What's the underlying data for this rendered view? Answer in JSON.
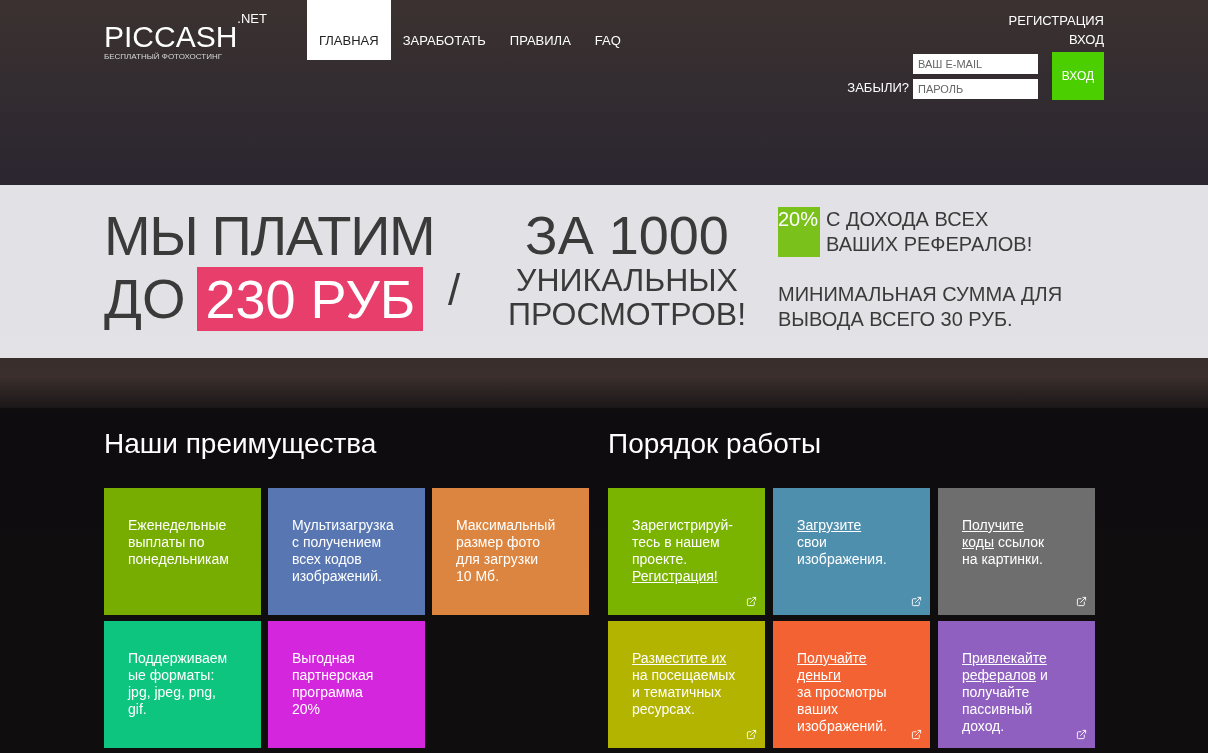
{
  "logo": {
    "name": "PICCASH",
    "tld": ".NET",
    "tagline": "БЕСПЛАТНЫЙ ФОТОХОСТИНГ"
  },
  "nav": [
    {
      "label": "ГЛАВНАЯ",
      "selected": true
    },
    {
      "label": "ЗАРАБОТАТЬ",
      "selected": false
    },
    {
      "label": "ПРАВИЛА",
      "selected": false
    },
    {
      "label": "FAQ",
      "selected": false
    }
  ],
  "account_links": [
    "РЕГИСТРАЦИЯ",
    "ВХОД"
  ],
  "login": {
    "forgot": "ЗАБЫЛИ?",
    "email_placeholder": "ВАШ E-MAIL",
    "password_placeholder": "ПАРОЛЬ",
    "submit": "ВХОД"
  },
  "banner": {
    "line1": "МЫ ПЛАТИМ",
    "line2_prefix": "ДО",
    "highlight": "230 РУБ",
    "slash": "/",
    "right_lines": [
      "ЗА 1000",
      "УНИКАЛЬНЫХ",
      "ПРОСМОТРОВ!"
    ],
    "referral_badge": "20%",
    "referral_text": "С ДОХОДА ВСЕХ ВАШИХ РЕФЕРАЛОВ!",
    "minimum_text": "МИНИМАЛЬНАЯ СУММА ДЛЯ ВЫВОДА ВСЕГО 30 РУБ."
  },
  "advantages": {
    "title": "Наши преимущества",
    "tiles": [
      {
        "color": "#76ad00",
        "lines": [
          [
            {
              "text": "Еженедельные"
            }
          ],
          [
            {
              "text": "выплаты по"
            }
          ],
          [
            {
              "text": "понедельникам"
            }
          ]
        ]
      },
      {
        "color": "#5877b2",
        "lines": [
          [
            {
              "text": "Мультизагрузка"
            }
          ],
          [
            {
              "text": "с получением"
            }
          ],
          [
            {
              "text": "всех кодов"
            }
          ],
          [
            {
              "text": "изображений."
            }
          ]
        ]
      },
      {
        "color": "#dc8540",
        "lines": [
          [
            {
              "text": "Максимальный"
            }
          ],
          [
            {
              "text": "размер фото"
            }
          ],
          [
            {
              "text": "для загрузки"
            }
          ],
          [
            {
              "text": "10 Мб."
            }
          ]
        ]
      },
      {
        "color": "#0ec57f",
        "lines": [
          [
            {
              "text": "Поддерживаем"
            }
          ],
          [
            {
              "text": "ые форматы:"
            }
          ],
          [
            {
              "text": "jpg, jpeg, png,"
            }
          ],
          [
            {
              "text": "gif."
            }
          ]
        ]
      },
      {
        "color": "#d426dc",
        "lines": [
          [
            {
              "text": "Выгодная"
            }
          ],
          [
            {
              "text": "партнерская"
            }
          ],
          [
            {
              "text": "программа"
            }
          ],
          [
            {
              "text": "20%"
            }
          ]
        ]
      }
    ]
  },
  "workflow": {
    "title": "Порядок работы",
    "tiles": [
      {
        "color": "#7ab300",
        "lines": [
          [
            {
              "text": "Зарегистрируй-"
            }
          ],
          [
            {
              "text": "тесь в нашем"
            }
          ],
          [
            {
              "text": "проекте."
            }
          ],
          [
            {
              "text": "Регистрация!",
              "link": true
            }
          ]
        ]
      },
      {
        "color": "#4f8fae",
        "lines": [
          [
            {
              "text": "Загрузите",
              "link": true
            }
          ],
          [
            {
              "text": "свои"
            }
          ],
          [
            {
              "text": "изображения."
            }
          ]
        ]
      },
      {
        "color": "#6e6e6e",
        "lines": [
          [
            {
              "text": "Получите",
              "link": true
            }
          ],
          [
            {
              "text": "коды",
              "link": true
            },
            {
              "text": " ссылок"
            }
          ],
          [
            {
              "text": "на картинки."
            }
          ]
        ]
      },
      {
        "color": "#b2b400",
        "lines": [
          [
            {
              "text": "Разместите их",
              "link": true
            }
          ],
          [
            {
              "text": "на посещаемых"
            }
          ],
          [
            {
              "text": "и тематичных"
            }
          ],
          [
            {
              "text": "ресурсах."
            }
          ]
        ]
      },
      {
        "color": "#f26232",
        "lines": [
          [
            {
              "text": "Получайте",
              "link": true
            }
          ],
          [
            {
              "text": "деньги",
              "link": true
            }
          ],
          [
            {
              "text": "за просмотры"
            }
          ],
          [
            {
              "text": "ваших"
            }
          ],
          [
            {
              "text": "изображений."
            }
          ]
        ]
      },
      {
        "color": "#9060c0",
        "lines": [
          [
            {
              "text": "Привлекайте",
              "link": true
            }
          ],
          [
            {
              "text": "рефералов",
              "link": true
            },
            {
              "text": " и"
            }
          ],
          [
            {
              "text": "получайте"
            }
          ],
          [
            {
              "text": "пассивный"
            }
          ],
          [
            {
              "text": "доход."
            }
          ]
        ]
      }
    ]
  }
}
